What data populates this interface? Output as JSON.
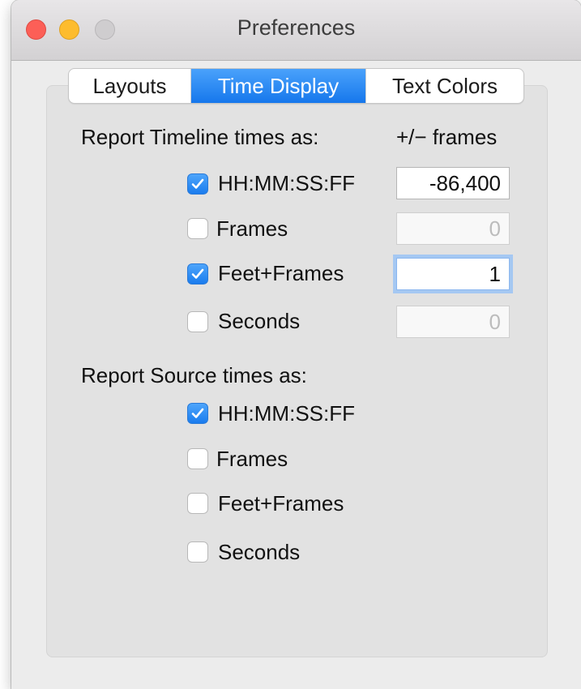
{
  "window": {
    "title": "Preferences"
  },
  "tabs": [
    {
      "label": "Layouts",
      "selected": false
    },
    {
      "label": "Time Display",
      "selected": true
    },
    {
      "label": "Text Colors",
      "selected": false
    }
  ],
  "timeline": {
    "heading": "Report Timeline times as:",
    "frames_header": "+/− frames",
    "options": [
      {
        "label": "HH:MM:SS:FF",
        "checked": true,
        "value": "-86,400",
        "enabled": true
      },
      {
        "label": "Frames",
        "checked": false,
        "value": "0",
        "enabled": false
      },
      {
        "label": "Feet+Frames",
        "checked": true,
        "value": "1",
        "enabled": true
      },
      {
        "label": "Seconds",
        "checked": false,
        "value": "0",
        "enabled": false
      }
    ]
  },
  "source": {
    "heading": "Report Source times as:",
    "options": [
      {
        "label": "HH:MM:SS:FF",
        "checked": true
      },
      {
        "label": "Frames",
        "checked": false
      },
      {
        "label": "Feet+Frames",
        "checked": false
      },
      {
        "label": "Seconds",
        "checked": false
      }
    ]
  },
  "colors": {
    "accent": "#1a7cee",
    "close": "#fc5f57",
    "minimize": "#fdbc2e",
    "zoom_disabled": "#cfcdcf"
  }
}
